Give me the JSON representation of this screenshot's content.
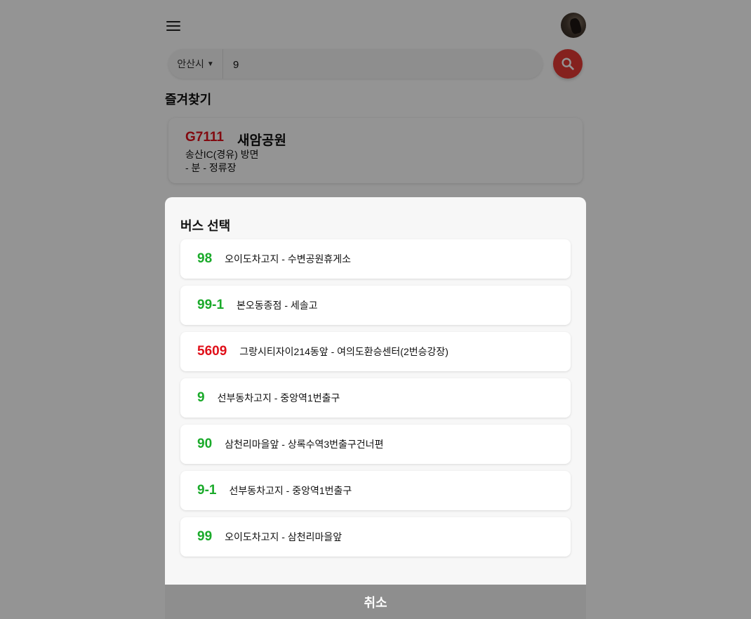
{
  "header": {
    "menu_icon": "hamburger-menu-icon",
    "avatar_icon": "user-avatar"
  },
  "search": {
    "city": "안산시",
    "value": "9",
    "button_icon": "search-icon",
    "button_color": "#e53935"
  },
  "favorites": {
    "title": "즐겨찾기",
    "items": [
      {
        "route": "G7111",
        "stop": "새암공원",
        "direction": "송산IC(경유) 방면",
        "eta": "- 분 - 정류장"
      }
    ]
  },
  "bus_select": {
    "title": "버스 선택",
    "items": [
      {
        "number": "98",
        "route": "오이도차고지 - 수변공원휴게소",
        "color": "green"
      },
      {
        "number": "99-1",
        "route": "본오동종점 - 세솔고",
        "color": "green"
      },
      {
        "number": "5609",
        "route": "그랑시티자이214동앞 - 여의도환승센터(2번승강장)",
        "color": "red"
      },
      {
        "number": "9",
        "route": "선부동차고지 - 중앙역1번출구",
        "color": "green"
      },
      {
        "number": "90",
        "route": "삼천리마을앞 - 상록수역3번출구건너편",
        "color": "green"
      },
      {
        "number": "9-1",
        "route": "선부동차고지 - 중앙역1번출구",
        "color": "green"
      },
      {
        "number": "99",
        "route": "오이도차고지 - 삼천리마을앞",
        "color": "green"
      }
    ],
    "cancel_label": "취소"
  },
  "colors": {
    "accent_red": "#e53935",
    "route_green": "#1aaa2a",
    "route_red": "#e0101a"
  }
}
